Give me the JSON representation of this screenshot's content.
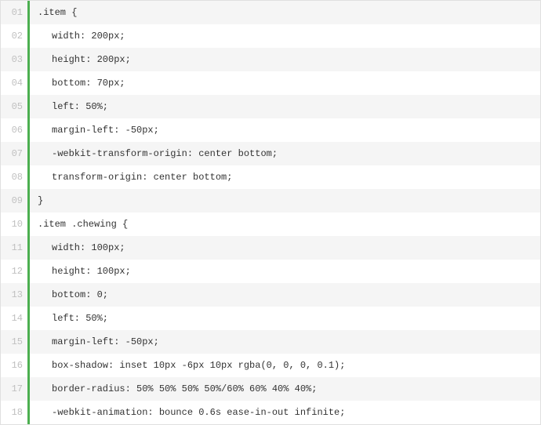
{
  "lines": [
    {
      "num": "01",
      "text": ".item {",
      "indent": false
    },
    {
      "num": "02",
      "text": "width: 200px;",
      "indent": true
    },
    {
      "num": "03",
      "text": "height: 200px;",
      "indent": true
    },
    {
      "num": "04",
      "text": "bottom: 70px;",
      "indent": true
    },
    {
      "num": "05",
      "text": "left: 50%;",
      "indent": true
    },
    {
      "num": "06",
      "text": "margin-left: -50px;",
      "indent": true
    },
    {
      "num": "07",
      "text": "-webkit-transform-origin: center bottom;",
      "indent": true
    },
    {
      "num": "08",
      "text": "transform-origin: center bottom;",
      "indent": true
    },
    {
      "num": "09",
      "text": "}",
      "indent": false
    },
    {
      "num": "10",
      "text": ".item .chewing {",
      "indent": false
    },
    {
      "num": "11",
      "text": "width: 100px;",
      "indent": true
    },
    {
      "num": "12",
      "text": "height: 100px;",
      "indent": true
    },
    {
      "num": "13",
      "text": "bottom: 0;",
      "indent": true
    },
    {
      "num": "14",
      "text": "left: 50%;",
      "indent": true
    },
    {
      "num": "15",
      "text": "margin-left: -50px;",
      "indent": true
    },
    {
      "num": "16",
      "text": "box-shadow: inset 10px -6px 10px rgba(0, 0, 0, 0.1);",
      "indent": true
    },
    {
      "num": "17",
      "text": "border-radius: 50% 50% 50% 50%/60% 60% 40% 40%;",
      "indent": true
    },
    {
      "num": "18",
      "text": "-webkit-animation: bounce 0.6s ease-in-out infinite;",
      "indent": true
    }
  ]
}
